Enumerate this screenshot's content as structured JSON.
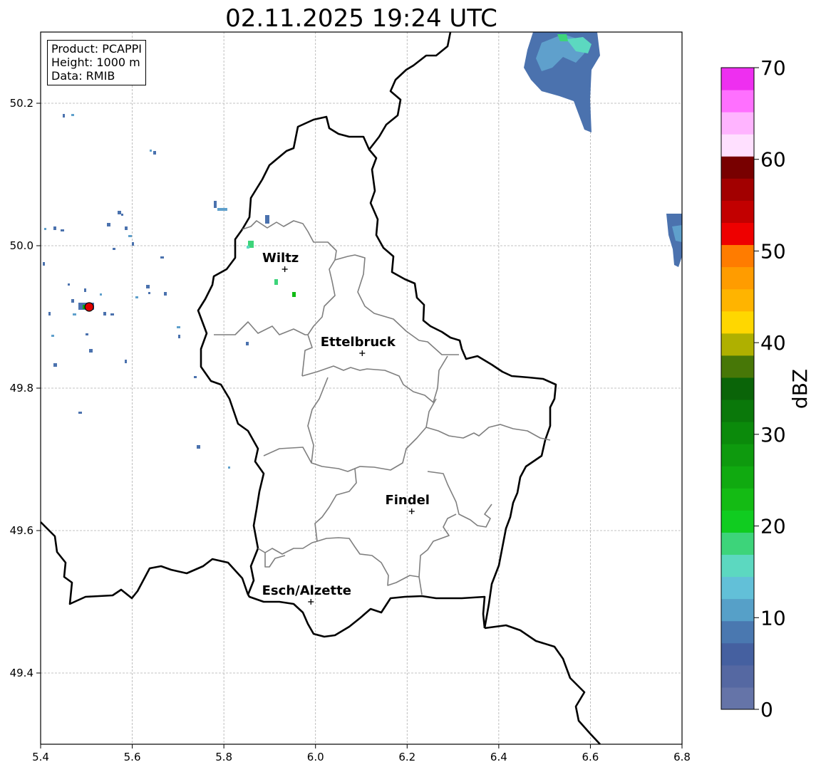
{
  "title": "02.11.2025 19:24 UTC",
  "info": {
    "product": "Product: PCAPPI",
    "height": "Height: 1000 m",
    "data": "Data: RMIB"
  },
  "axes": {
    "x_ticks": [
      "5.4",
      "5.6",
      "5.8",
      "6.0",
      "6.2",
      "6.4",
      "6.6",
      "6.8"
    ],
    "y_ticks": [
      "50.2",
      "50.0",
      "49.8",
      "49.6",
      "49.4"
    ],
    "x_range": [
      5.4,
      6.8
    ],
    "y_range": [
      49.3,
      50.3
    ],
    "grid": true
  },
  "cities": [
    {
      "name": "Wiltz",
      "lon": 5.933,
      "lat": 49.967
    },
    {
      "name": "Ettelbruck",
      "lon": 6.102,
      "lat": 49.849
    },
    {
      "name": "Findel",
      "lon": 6.21,
      "lat": 49.627
    },
    {
      "name": "Esch/Alzette",
      "lon": 5.99,
      "lat": 49.5
    }
  ],
  "radar_site": {
    "lon": 5.506,
    "lat": 49.914,
    "color": "#e00000"
  },
  "colorbar": {
    "label": "dBZ",
    "ticks": [
      "0",
      "10",
      "20",
      "30",
      "40",
      "50",
      "60",
      "70"
    ],
    "colors": [
      "#6574a8",
      "#5568a2",
      "#4560a0",
      "#4a78b0",
      "#56a0c8",
      "#62c0d8",
      "#5cd8c0",
      "#3dd47a",
      "#10cc20",
      "#14bb14",
      "#10aa10",
      "#0e9a0e",
      "#0b8a0b",
      "#0a780a",
      "#0a6408",
      "#477707",
      "#afb000",
      "#ffd700",
      "#ffb400",
      "#ff9c00",
      "#ff7c00",
      "#ee0000",
      "#c20000",
      "#a20000",
      "#780000",
      "#ffe0ff",
      "#ffb4ff",
      "#ff70ff",
      "#ee2ff0"
    ]
  }
}
